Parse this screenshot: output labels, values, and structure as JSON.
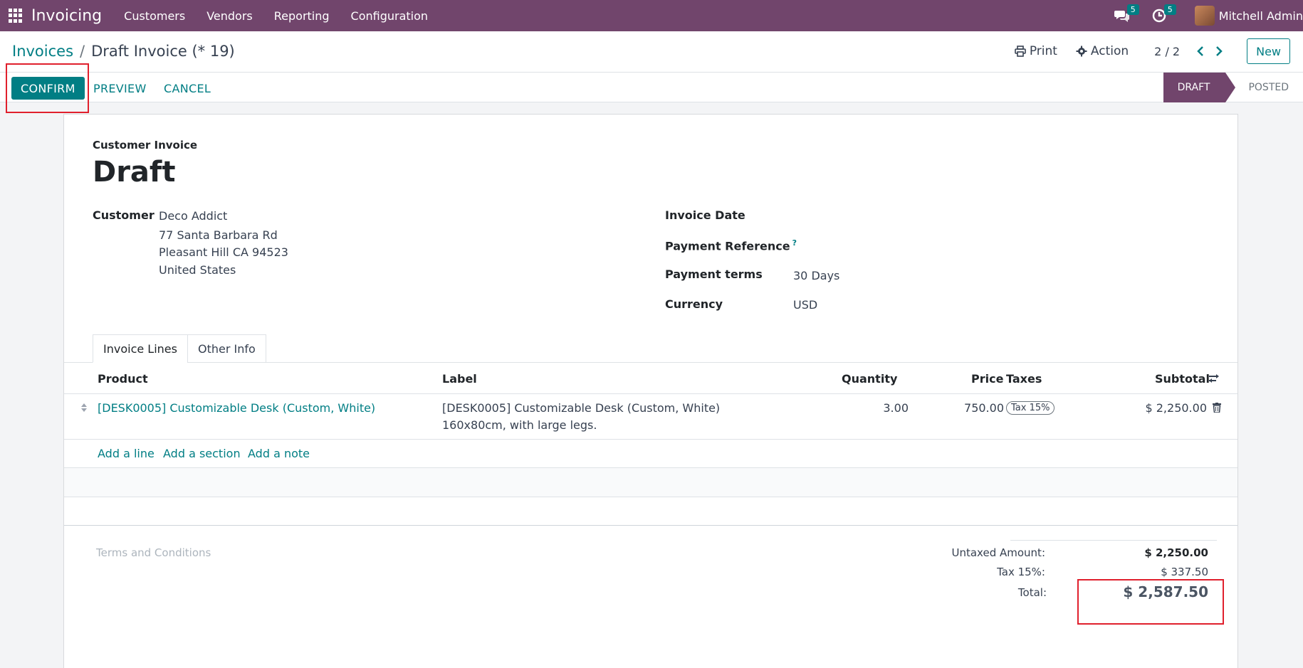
{
  "navbar": {
    "brand": "Invoicing",
    "menu": [
      "Customers",
      "Vendors",
      "Reporting",
      "Configuration"
    ],
    "messages_badge": "5",
    "activities_badge": "5",
    "user_name": "Mitchell Admin"
  },
  "breadcrumb": {
    "parent": "Invoices",
    "separator": "/",
    "current": "Draft Invoice (* 19)"
  },
  "control": {
    "print_label": "Print",
    "action_label": "Action",
    "pager": "2 / 2",
    "new_label": "New"
  },
  "buttons": {
    "confirm": "CONFIRM",
    "preview": "PREVIEW",
    "cancel": "CANCEL"
  },
  "status": {
    "draft": "DRAFT",
    "posted": "POSTED"
  },
  "invoice": {
    "type_label": "Customer Invoice",
    "title": "Draft",
    "customer_label": "Customer",
    "customer_name": "Deco Addict",
    "address_line1": "77 Santa Barbara Rd",
    "address_line2": "Pleasant Hill CA 94523",
    "address_line3": "United States",
    "invoice_date_label": "Invoice Date",
    "payment_reference_label": "Payment Reference",
    "payment_reference_help": "?",
    "payment_terms_label": "Payment terms",
    "payment_terms_value": "30 Days",
    "currency_label": "Currency",
    "currency_value": "USD"
  },
  "tabs": [
    "Invoice Lines",
    "Other Info"
  ],
  "lines": {
    "headers": {
      "product": "Product",
      "label": "Label",
      "quantity": "Quantity",
      "price": "Price",
      "taxes": "Taxes",
      "subtotal": "Subtotal"
    },
    "rows": [
      {
        "product": "[DESK0005] Customizable Desk (Custom, White)",
        "label_line1": "[DESK0005] Customizable Desk (Custom, White)",
        "label_line2": "160x80cm, with large legs.",
        "quantity": "3.00",
        "price": "750.00",
        "tax": "Tax 15%",
        "subtotal": "$ 2,250.00"
      }
    ],
    "add_line": "Add a line",
    "add_section": "Add a section",
    "add_note": "Add a note"
  },
  "terms_placeholder": "Terms and Conditions",
  "totals": {
    "untaxed_label": "Untaxed Amount:",
    "untaxed_value": "$ 2,250.00",
    "tax_label": "Tax 15%:",
    "tax_value": "$ 337.50",
    "total_label": "Total:",
    "total_value": "$ 2,587.50"
  }
}
